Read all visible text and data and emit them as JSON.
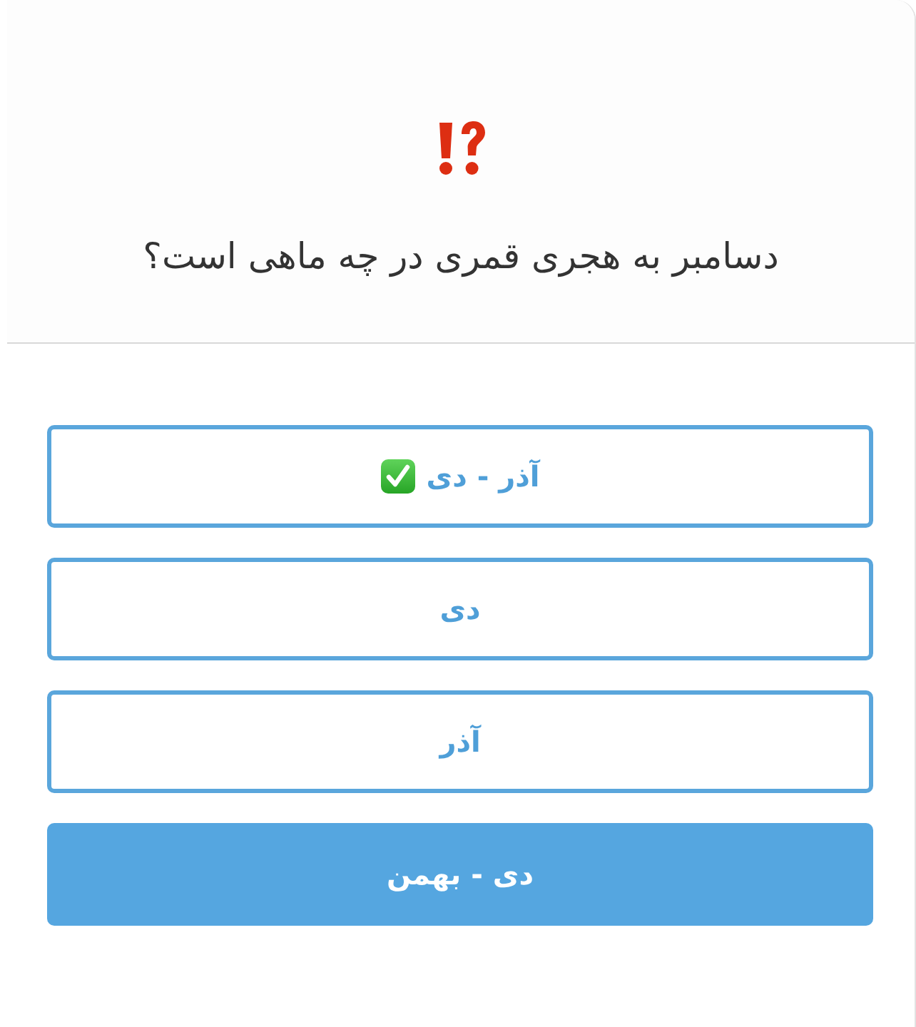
{
  "question": {
    "text": "دسامبر به هجری قمری در چه ماهی است؟"
  },
  "options": [
    {
      "label": "آذر - دی",
      "correct": true,
      "selected": false
    },
    {
      "label": "دی",
      "correct": false,
      "selected": false
    },
    {
      "label": "آذر",
      "correct": false,
      "selected": false
    },
    {
      "label": "دی - بهمن",
      "correct": false,
      "selected": true
    }
  ]
}
